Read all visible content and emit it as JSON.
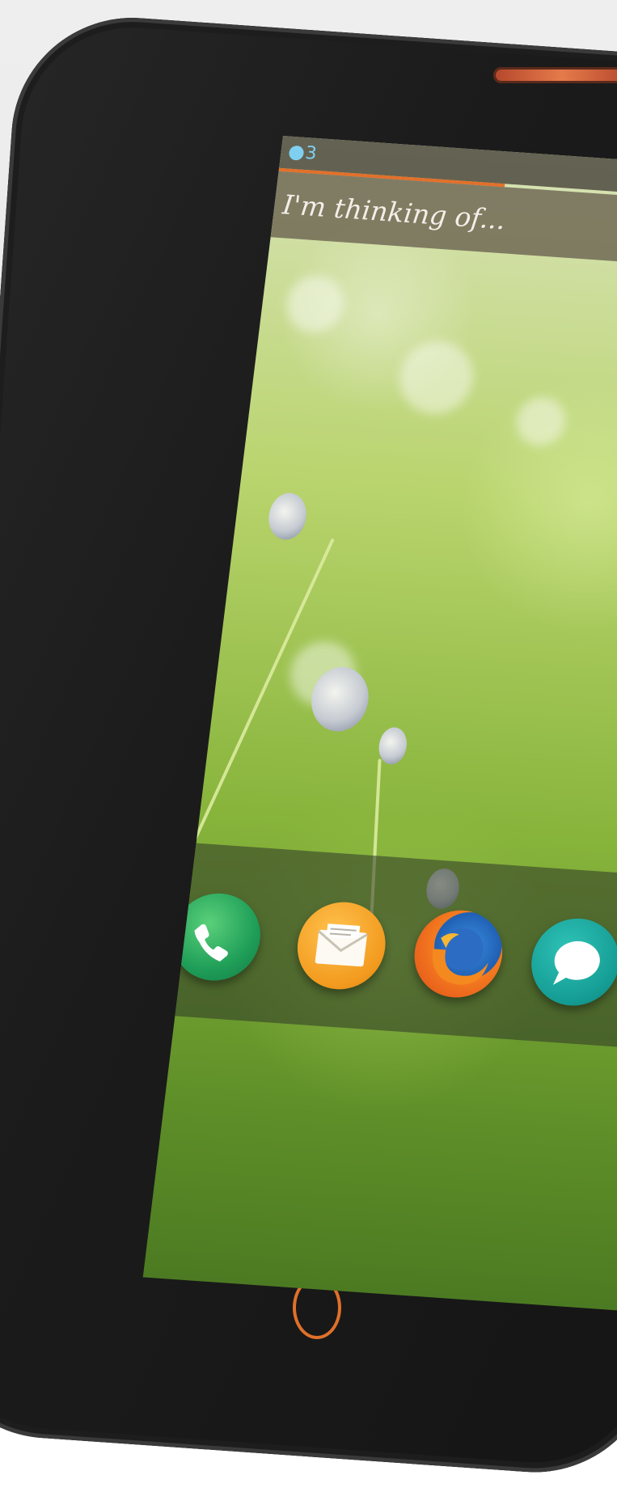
{
  "status_bar": {
    "notification_count": "3"
  },
  "search": {
    "placeholder": "I'm thinking of..."
  },
  "dock": {
    "apps": [
      {
        "icon": "phone-handset-icon"
      },
      {
        "icon": "envelope-icon"
      },
      {
        "icon": "browser-fox-icon"
      },
      {
        "icon": "speech-bubble-icon"
      }
    ]
  },
  "colors": {
    "accent": "#e2702b",
    "status_text": "#7fd0f0"
  }
}
